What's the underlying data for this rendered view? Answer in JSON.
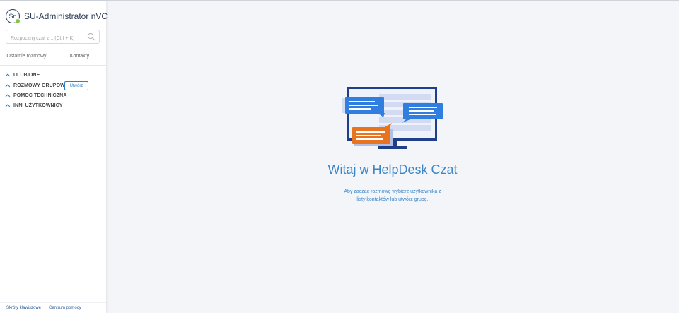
{
  "sidebar": {
    "avatar_initials": "Sn",
    "user_name": "SU-Administrator nVC",
    "search_placeholder": "Rozpocznij czat z... (Ctrl + K)",
    "tabs": [
      {
        "label": "Ostatnie rozmowy",
        "active": false
      },
      {
        "label": "Kontakty",
        "active": true
      }
    ],
    "groups": [
      {
        "label": "ULUBIONE"
      },
      {
        "label": "ROZMOWY GRUPOWE"
      },
      {
        "label": "POMOC TECHNICZNA"
      },
      {
        "label": "INNI UŻYTKOWNICY"
      }
    ],
    "create_button_label": "Utwórz",
    "footer": {
      "shortcuts_link": "Skróty klawiszowe",
      "help_link": "Centrum pomocy"
    }
  },
  "main": {
    "welcome_title": "Witaj w HelpDesk Czat",
    "welcome_line1": "Aby zacząć rozmowę wybierz użytkownika z",
    "welcome_line2": "listy kontaktów lub utwórz grupę."
  },
  "colors": {
    "accent": "#2f7ec6",
    "presence_online": "#8bc34a",
    "bubble_orange": "#e8741f",
    "bubble_blue": "#2f7ee0",
    "monitor_frame": "#1f3f8a"
  },
  "icons": {
    "search": "search-icon",
    "chevron": "chevron-up-icon"
  }
}
